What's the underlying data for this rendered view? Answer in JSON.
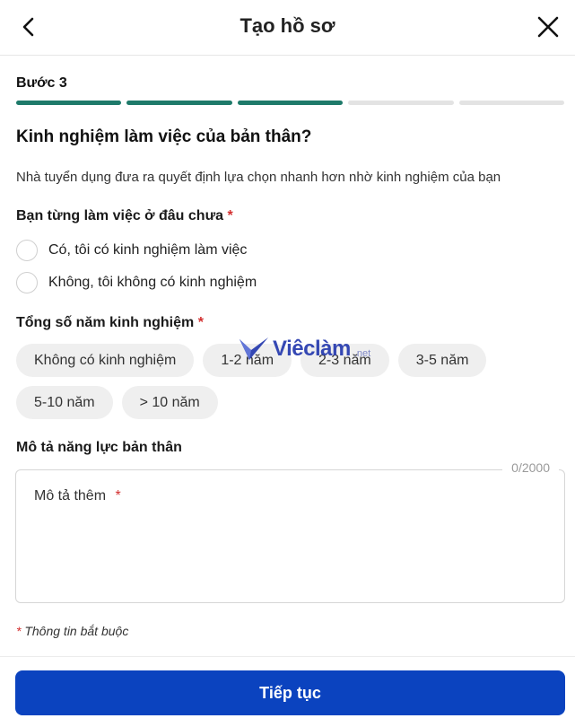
{
  "header": {
    "title": "Tạo hồ sơ",
    "back_icon": "chevron-left-icon",
    "close_icon": "close-icon"
  },
  "step": {
    "label": "Bước 3",
    "current": 3,
    "total": 5
  },
  "question": "Kinh nghiệm làm việc của bản thân?",
  "description": "Nhà tuyển dụng đưa ra quyết định lựa chọn nhanh hơn nhờ kinh nghiệm của bạn",
  "worked_before": {
    "label": "Bạn từng làm việc ở đâu chưa",
    "required_mark": "*",
    "options": [
      {
        "label": "Có, tôi có kinh nghiệm làm việc",
        "selected": false
      },
      {
        "label": "Không, tôi không có kinh nghiệm",
        "selected": false
      }
    ]
  },
  "years_experience": {
    "label": "Tổng số năm kinh nghiệm",
    "required_mark": "*",
    "options": [
      "Không có kinh nghiệm",
      "1-2 năm",
      "2-3 năm",
      "3-5 năm",
      "5-10 năm",
      "> 10 năm"
    ]
  },
  "self_description": {
    "label": "Mô tả năng lực bản thân",
    "counter": "0/2000",
    "placeholder": "Mô tả thêm",
    "required_mark": "*"
  },
  "required_note": {
    "mark": "*",
    "text": "Thông tin bắt buộc"
  },
  "watermark": {
    "text": "Viêclàm",
    "suffix": ".net"
  },
  "footer": {
    "continue_label": "Tiếp tục"
  },
  "colors": {
    "accent": "#0b43bf",
    "progress_done": "#1e7a6a",
    "progress_todo": "#e3e3e3",
    "required": "#d32f2f",
    "watermark": "#2b3fb0"
  }
}
